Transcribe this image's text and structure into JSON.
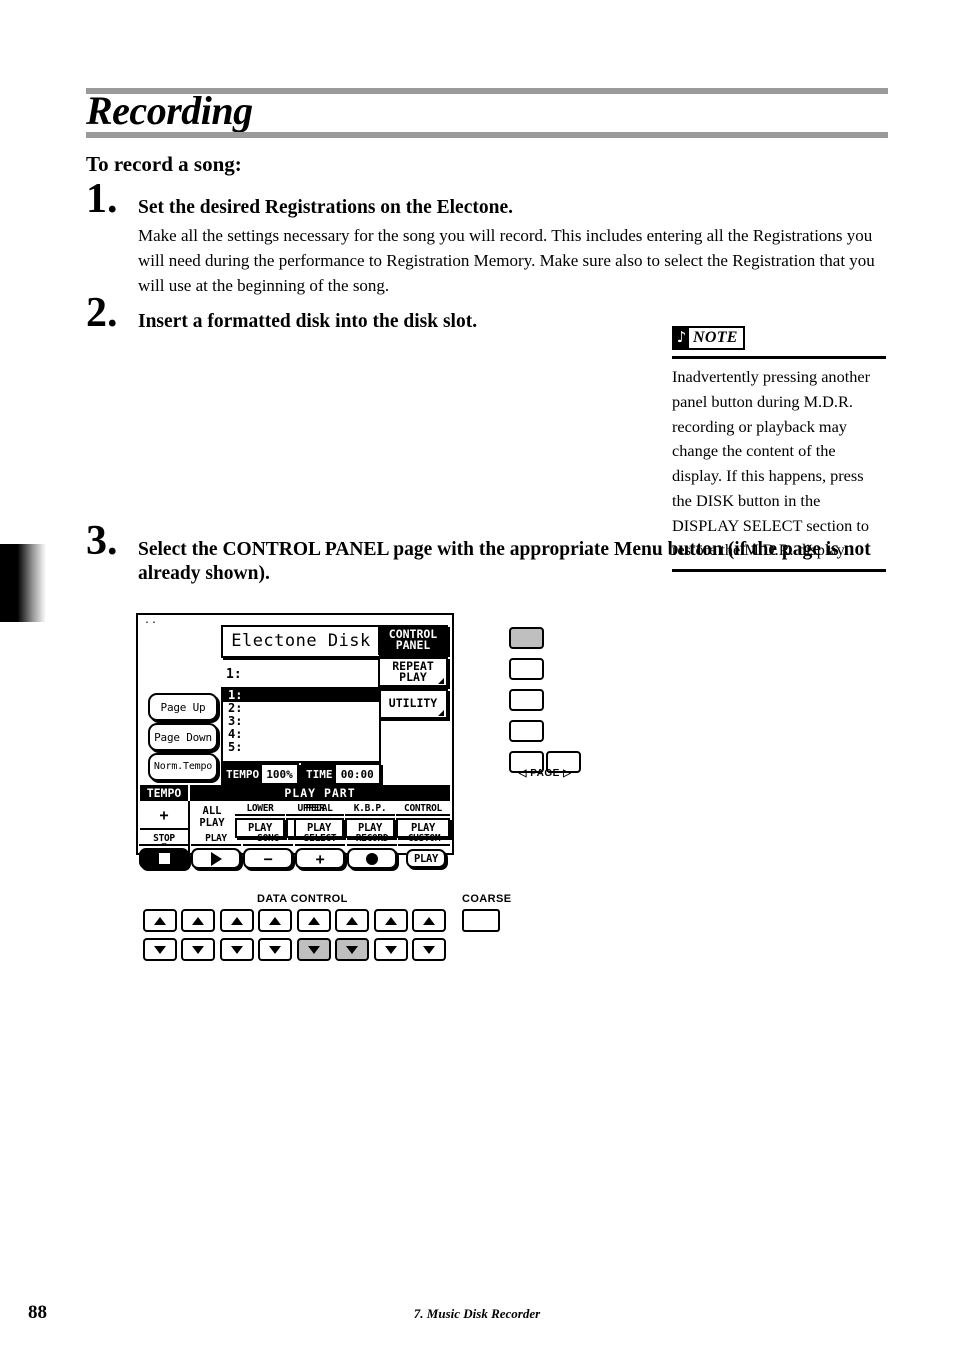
{
  "document": {
    "title": "Recording",
    "subhead": "To record a song:",
    "page_number": "88",
    "footer": "7. Music Disk Recorder"
  },
  "steps": [
    {
      "number": "1.",
      "heading": "Set the desired Registrations on the Electone.",
      "text": "Make all the settings necessary for the song you will record.  This includes entering all the Registrations you will need during the performance to Registration Memory.  Make sure also to select the Registration that you will use at the beginning of the song."
    },
    {
      "number": "2.",
      "heading": "Insert a formatted disk into the disk slot.",
      "text": ""
    },
    {
      "number": "3.",
      "heading": "Select the CONTROL PANEL page with the appropriate Menu button (if the page is not already shown).",
      "text": ""
    }
  ],
  "note": {
    "icon": "music-note-icon",
    "label": "NOTE",
    "body": "Inadvertently pressing another panel button during M.D.R. recording or playback may change the content of the display.  If this happens, press the DISK button in the DISPLAY SELECT section to restore the M.D.R. display."
  },
  "lcd": {
    "corner_dots": "..",
    "title": "Electone Disk",
    "current_label": "1:",
    "menu_buttons": [
      {
        "line1": "CONTROL",
        "line2": "PANEL",
        "selected": true
      },
      {
        "line1": "REPEAT",
        "line2": "PLAY",
        "selected": false
      },
      {
        "line1": "UTILITY",
        "line2": "",
        "selected": false
      }
    ],
    "side_buttons": [
      {
        "label": "Page Up"
      },
      {
        "label": "Page Down"
      },
      {
        "label": "Norm.Tempo"
      }
    ],
    "song_list": [
      {
        "label": "1:",
        "selected": true
      },
      {
        "label": "2:",
        "selected": false
      },
      {
        "label": "3:",
        "selected": false
      },
      {
        "label": "4:",
        "selected": false
      },
      {
        "label": "5:",
        "selected": false
      }
    ],
    "meters": [
      {
        "key": "TEMPO",
        "value": "100%"
      },
      {
        "key": "TIME",
        "value": "00:00"
      }
    ],
    "section_bar": {
      "left": "TEMPO",
      "main": "PLAY PART"
    },
    "tempo_column": {
      "plus": "+",
      "minus": "-"
    },
    "play_part_row": [
      {
        "caption": "",
        "button": "ALL\nPLAY",
        "boxed": false
      },
      {
        "caption": "LOWER",
        "button": "PLAY",
        "boxed": true
      },
      {
        "caption": "UPPER",
        "button": "PLAY",
        "boxed": true
      },
      {
        "caption": "PEDAL",
        "button": "PLAY",
        "boxed": true
      },
      {
        "caption": "K.B.P.",
        "button": "PLAY",
        "boxed": true
      },
      {
        "caption": "CONTROL",
        "button": "PLAY",
        "boxed": true
      }
    ],
    "transport_row": [
      {
        "caption": "STOP",
        "icon": "stop-square-icon",
        "inverted": true
      },
      {
        "caption": "PLAY",
        "icon": "play-triangle-icon",
        "inverted": false
      },
      {
        "caption": "SONG",
        "icon": "minus-icon",
        "inverted": false
      },
      {
        "caption": "SELECT",
        "icon": "plus-icon",
        "inverted": false
      },
      {
        "caption": "RECORD",
        "icon": "record-dot-icon",
        "inverted": false
      },
      {
        "caption": "CUSTOM",
        "icon": "",
        "label": "PLAY",
        "inverted": false
      }
    ]
  },
  "panel": {
    "menu_buttons": [
      {
        "active": true
      },
      {
        "active": false
      },
      {
        "active": false
      },
      {
        "active": false
      }
    ],
    "page_buttons": [
      {
        "active": false
      },
      {
        "active": false
      }
    ],
    "page_label": "PAGE",
    "page_left_icon": "triangle-left-icon",
    "page_right_icon": "triangle-right-icon"
  },
  "data_control": {
    "label": "DATA CONTROL",
    "coarse_label": "COARSE",
    "up_icon": "triangle-up-icon",
    "down_icon": "triangle-down-icon",
    "columns": [
      {
        "up_active": false,
        "down_active": false
      },
      {
        "up_active": false,
        "down_active": false
      },
      {
        "up_active": false,
        "down_active": false
      },
      {
        "up_active": false,
        "down_active": false
      },
      {
        "up_active": false,
        "down_active": true
      },
      {
        "up_active": false,
        "down_active": true
      },
      {
        "up_active": false,
        "down_active": false
      },
      {
        "up_active": false,
        "down_active": false
      }
    ]
  },
  "colors": {
    "rule": "#9a9a9a",
    "active_button": "#bfbfbf",
    "ink": "#000000",
    "paper": "#ffffff"
  }
}
